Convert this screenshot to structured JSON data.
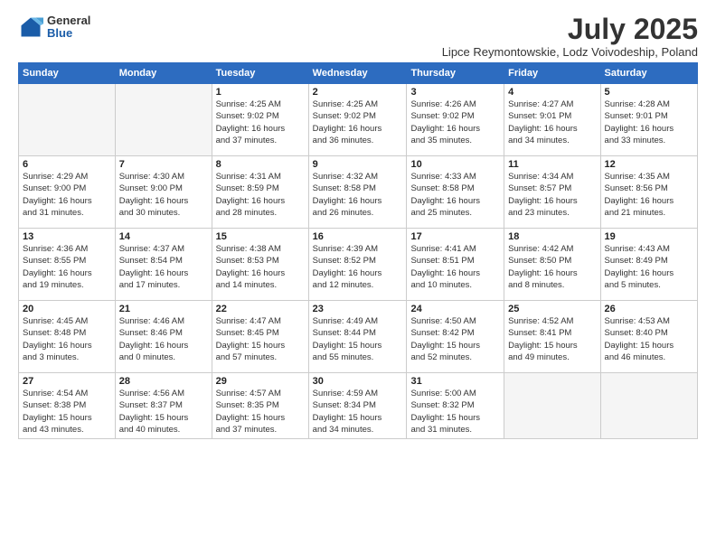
{
  "logo": {
    "general": "General",
    "blue": "Blue"
  },
  "title": "July 2025",
  "subtitle": "Lipce Reymontowskie, Lodz Voivodeship, Poland",
  "headers": [
    "Sunday",
    "Monday",
    "Tuesday",
    "Wednesday",
    "Thursday",
    "Friday",
    "Saturday"
  ],
  "weeks": [
    [
      {
        "num": "",
        "info": ""
      },
      {
        "num": "",
        "info": ""
      },
      {
        "num": "1",
        "info": "Sunrise: 4:25 AM\nSunset: 9:02 PM\nDaylight: 16 hours\nand 37 minutes."
      },
      {
        "num": "2",
        "info": "Sunrise: 4:25 AM\nSunset: 9:02 PM\nDaylight: 16 hours\nand 36 minutes."
      },
      {
        "num": "3",
        "info": "Sunrise: 4:26 AM\nSunset: 9:02 PM\nDaylight: 16 hours\nand 35 minutes."
      },
      {
        "num": "4",
        "info": "Sunrise: 4:27 AM\nSunset: 9:01 PM\nDaylight: 16 hours\nand 34 minutes."
      },
      {
        "num": "5",
        "info": "Sunrise: 4:28 AM\nSunset: 9:01 PM\nDaylight: 16 hours\nand 33 minutes."
      }
    ],
    [
      {
        "num": "6",
        "info": "Sunrise: 4:29 AM\nSunset: 9:00 PM\nDaylight: 16 hours\nand 31 minutes."
      },
      {
        "num": "7",
        "info": "Sunrise: 4:30 AM\nSunset: 9:00 PM\nDaylight: 16 hours\nand 30 minutes."
      },
      {
        "num": "8",
        "info": "Sunrise: 4:31 AM\nSunset: 8:59 PM\nDaylight: 16 hours\nand 28 minutes."
      },
      {
        "num": "9",
        "info": "Sunrise: 4:32 AM\nSunset: 8:58 PM\nDaylight: 16 hours\nand 26 minutes."
      },
      {
        "num": "10",
        "info": "Sunrise: 4:33 AM\nSunset: 8:58 PM\nDaylight: 16 hours\nand 25 minutes."
      },
      {
        "num": "11",
        "info": "Sunrise: 4:34 AM\nSunset: 8:57 PM\nDaylight: 16 hours\nand 23 minutes."
      },
      {
        "num": "12",
        "info": "Sunrise: 4:35 AM\nSunset: 8:56 PM\nDaylight: 16 hours\nand 21 minutes."
      }
    ],
    [
      {
        "num": "13",
        "info": "Sunrise: 4:36 AM\nSunset: 8:55 PM\nDaylight: 16 hours\nand 19 minutes."
      },
      {
        "num": "14",
        "info": "Sunrise: 4:37 AM\nSunset: 8:54 PM\nDaylight: 16 hours\nand 17 minutes."
      },
      {
        "num": "15",
        "info": "Sunrise: 4:38 AM\nSunset: 8:53 PM\nDaylight: 16 hours\nand 14 minutes."
      },
      {
        "num": "16",
        "info": "Sunrise: 4:39 AM\nSunset: 8:52 PM\nDaylight: 16 hours\nand 12 minutes."
      },
      {
        "num": "17",
        "info": "Sunrise: 4:41 AM\nSunset: 8:51 PM\nDaylight: 16 hours\nand 10 minutes."
      },
      {
        "num": "18",
        "info": "Sunrise: 4:42 AM\nSunset: 8:50 PM\nDaylight: 16 hours\nand 8 minutes."
      },
      {
        "num": "19",
        "info": "Sunrise: 4:43 AM\nSunset: 8:49 PM\nDaylight: 16 hours\nand 5 minutes."
      }
    ],
    [
      {
        "num": "20",
        "info": "Sunrise: 4:45 AM\nSunset: 8:48 PM\nDaylight: 16 hours\nand 3 minutes."
      },
      {
        "num": "21",
        "info": "Sunrise: 4:46 AM\nSunset: 8:46 PM\nDaylight: 16 hours\nand 0 minutes."
      },
      {
        "num": "22",
        "info": "Sunrise: 4:47 AM\nSunset: 8:45 PM\nDaylight: 15 hours\nand 57 minutes."
      },
      {
        "num": "23",
        "info": "Sunrise: 4:49 AM\nSunset: 8:44 PM\nDaylight: 15 hours\nand 55 minutes."
      },
      {
        "num": "24",
        "info": "Sunrise: 4:50 AM\nSunset: 8:42 PM\nDaylight: 15 hours\nand 52 minutes."
      },
      {
        "num": "25",
        "info": "Sunrise: 4:52 AM\nSunset: 8:41 PM\nDaylight: 15 hours\nand 49 minutes."
      },
      {
        "num": "26",
        "info": "Sunrise: 4:53 AM\nSunset: 8:40 PM\nDaylight: 15 hours\nand 46 minutes."
      }
    ],
    [
      {
        "num": "27",
        "info": "Sunrise: 4:54 AM\nSunset: 8:38 PM\nDaylight: 15 hours\nand 43 minutes."
      },
      {
        "num": "28",
        "info": "Sunrise: 4:56 AM\nSunset: 8:37 PM\nDaylight: 15 hours\nand 40 minutes."
      },
      {
        "num": "29",
        "info": "Sunrise: 4:57 AM\nSunset: 8:35 PM\nDaylight: 15 hours\nand 37 minutes."
      },
      {
        "num": "30",
        "info": "Sunrise: 4:59 AM\nSunset: 8:34 PM\nDaylight: 15 hours\nand 34 minutes."
      },
      {
        "num": "31",
        "info": "Sunrise: 5:00 AM\nSunset: 8:32 PM\nDaylight: 15 hours\nand 31 minutes."
      },
      {
        "num": "",
        "info": ""
      },
      {
        "num": "",
        "info": ""
      }
    ]
  ]
}
